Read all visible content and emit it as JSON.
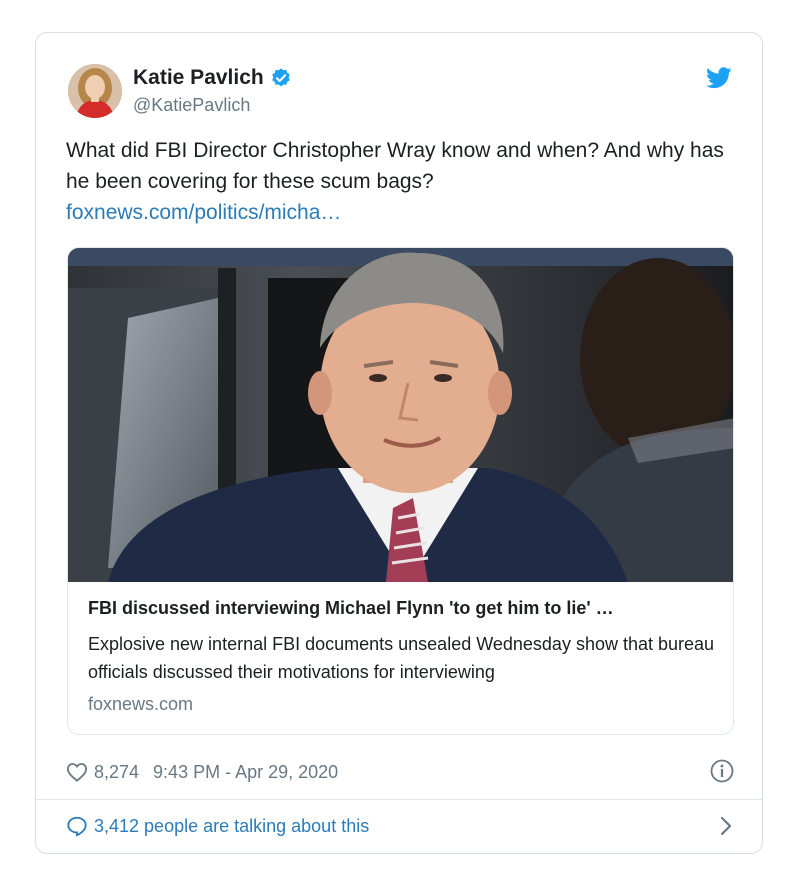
{
  "tweet": {
    "author": {
      "name": "Katie Pavlich",
      "handle": "@KatiePavlich",
      "verified": true
    },
    "text": "What did FBI Director Christopher Wray know and when? And why has he been covering for these scum bags?",
    "link_text": "foxnews.com/politics/micha…",
    "card": {
      "title": "FBI discussed interviewing Michael Flynn 'to get him to lie' …",
      "description": "Explosive new internal FBI documents unsealed Wednesday show that bureau officials discussed their motivations for interviewing",
      "domain": "foxnews.com"
    },
    "likes": "8,274",
    "timestamp": "9:43 PM - Apr 29, 2020",
    "talking": "3,412 people are talking about this"
  },
  "icons": {
    "brand": "twitter-bird-icon",
    "verified": "verified-badge-icon",
    "like": "heart-icon",
    "info": "info-icon",
    "reply": "speech-bubble-icon",
    "more": "chevron-right-icon"
  },
  "colors": {
    "twitter_blue": "#1da1f2",
    "link": "#2b7bb9",
    "text": "#1c2022",
    "muted": "#697882",
    "border": "#d8dde1"
  }
}
